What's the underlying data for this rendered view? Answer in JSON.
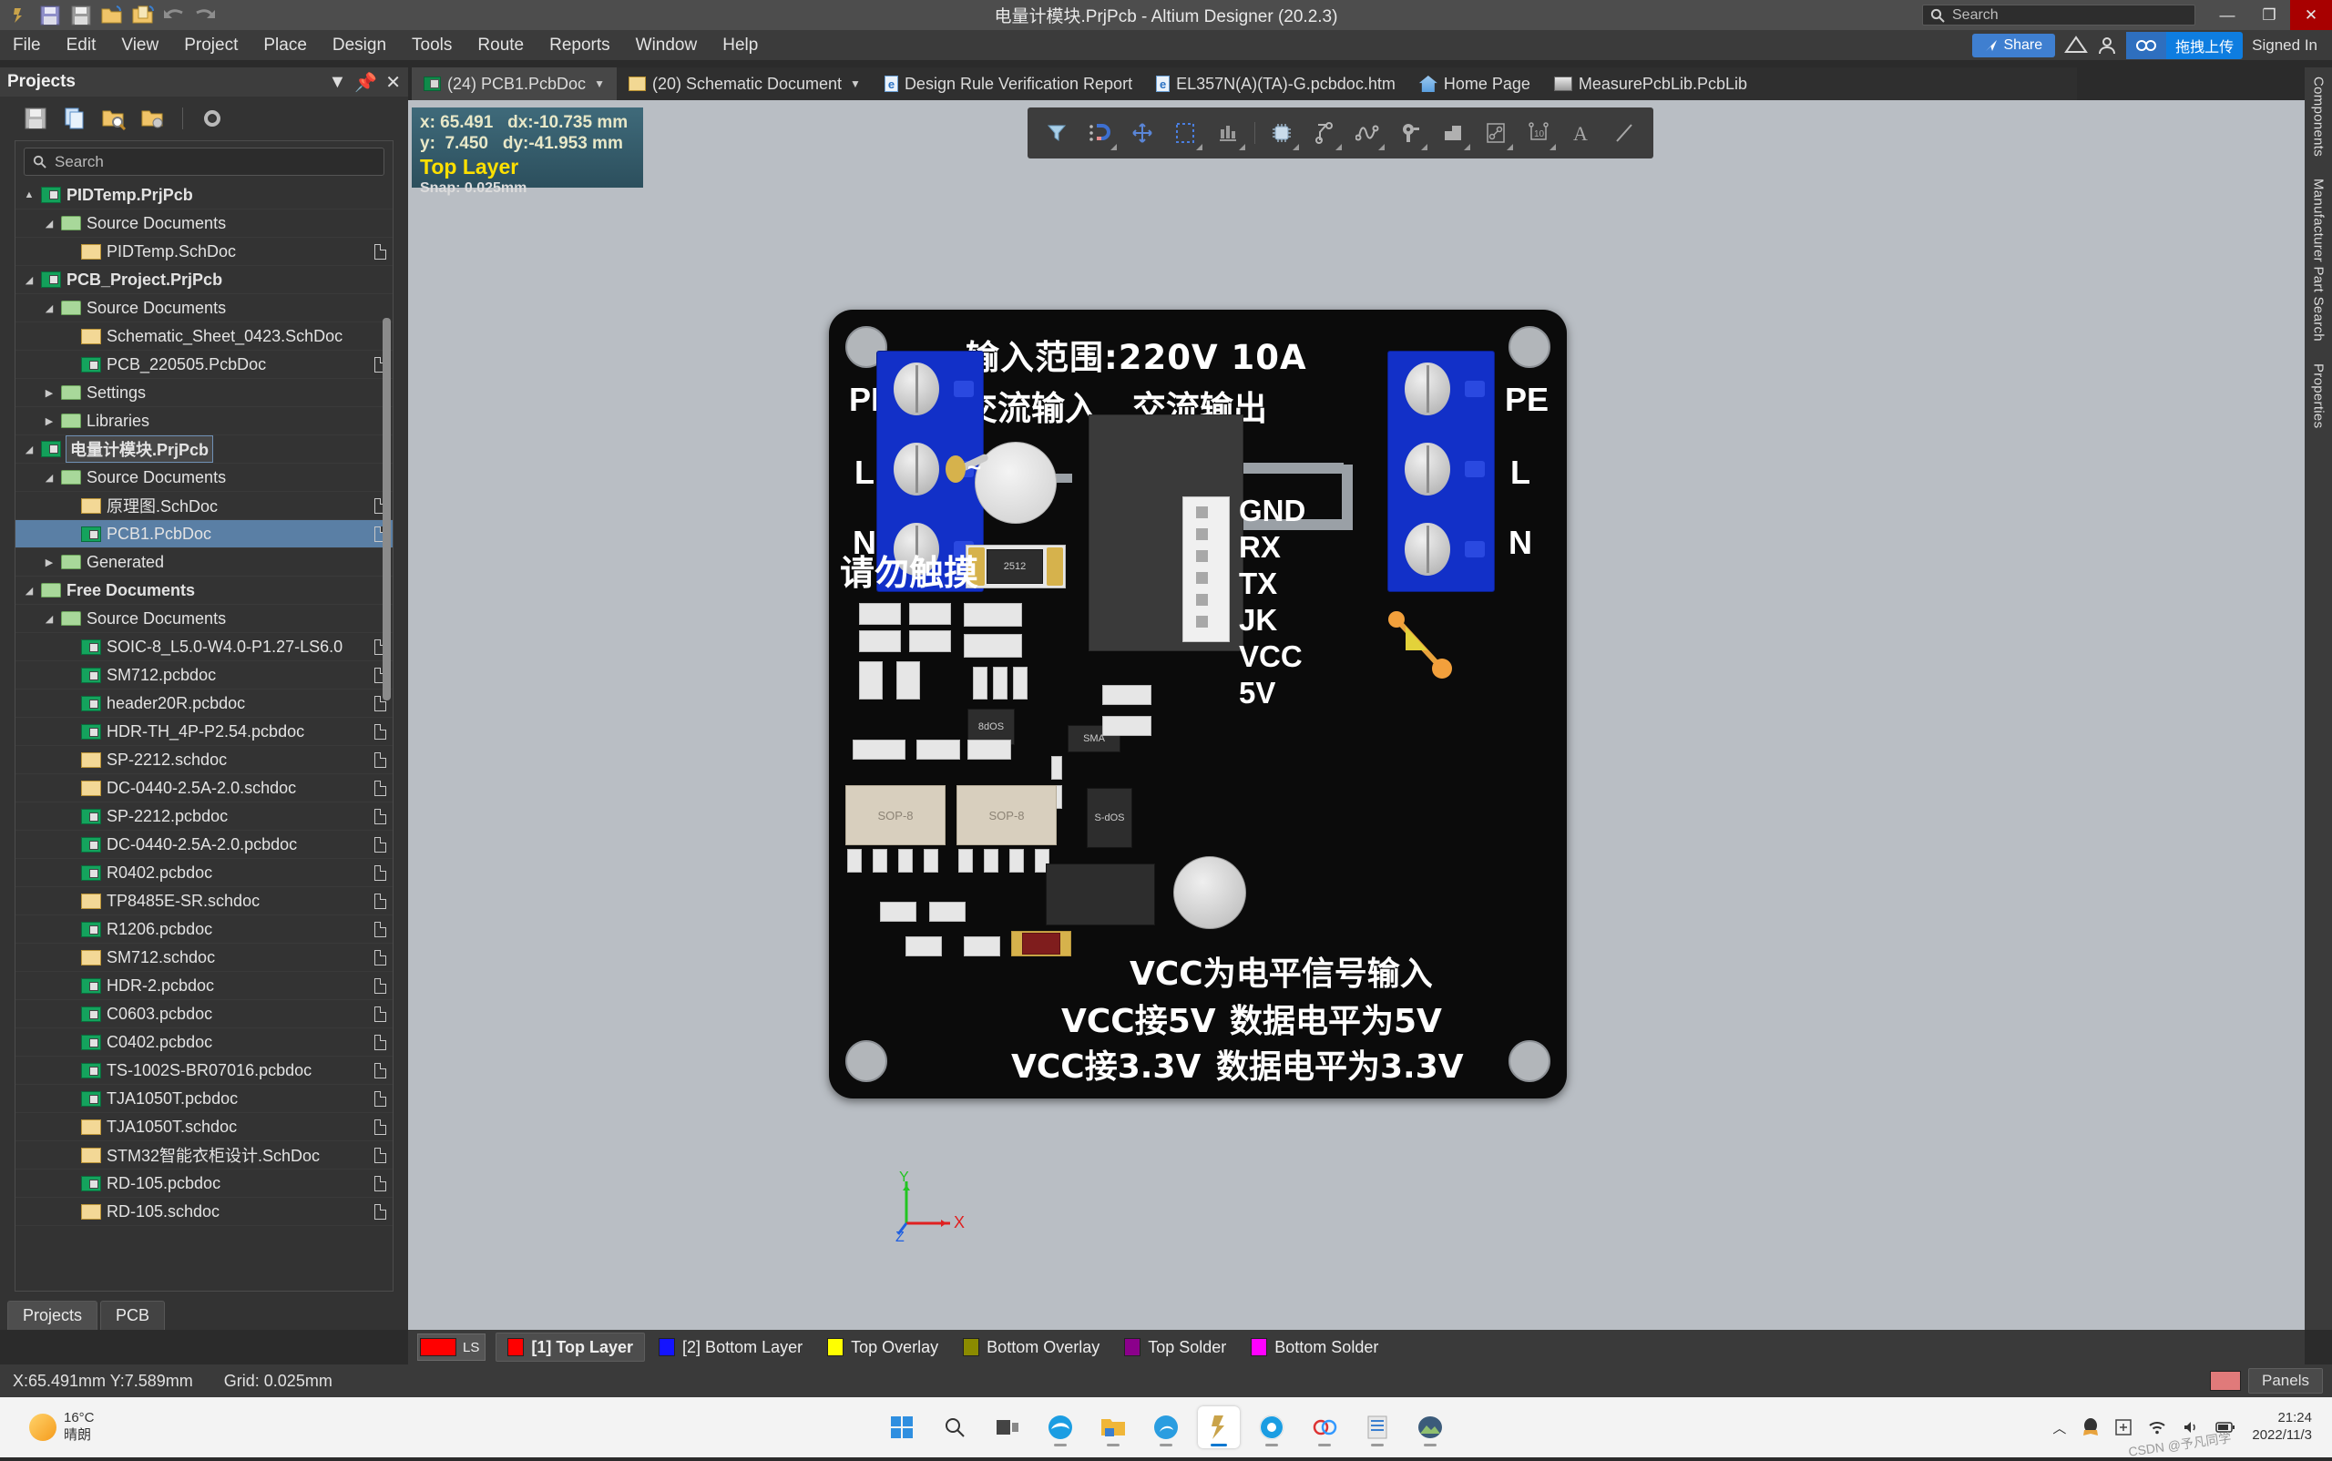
{
  "titlebar": {
    "title": "电量计模块.PrjPcb - Altium Designer (20.2.3)",
    "quick_access": [
      "altium-logo-icon",
      "save-icon",
      "save-all-icon",
      "open-folder-icon",
      "open-document-icon",
      "undo-icon",
      "redo-icon"
    ],
    "search_placeholder": "Search",
    "minimize": "—",
    "restore": "❐",
    "close": "✕"
  },
  "menubar": {
    "items": [
      "File",
      "Edit",
      "View",
      "Project",
      "Place",
      "Design",
      "Tools",
      "Route",
      "Reports",
      "Window",
      "Help"
    ],
    "share_label": "Share",
    "cloud_label": "拖拽上传",
    "signed_in": "Signed In"
  },
  "doc_tabs": [
    {
      "label": "(24) PCB1.PcbDoc",
      "icon": "pcb-doc-icon",
      "active": true,
      "caret": "▼"
    },
    {
      "label": "(20) Schematic Document",
      "icon": "schematic-doc-icon",
      "active": false,
      "caret": "▼"
    },
    {
      "label": "Design Rule Verification Report",
      "icon": "html-doc-icon",
      "active": false,
      "caret": ""
    },
    {
      "label": "EL357N(A)(TA)-G.pcbdoc.htm",
      "icon": "html-doc-icon",
      "active": false,
      "caret": ""
    },
    {
      "label": "Home Page",
      "icon": "home-icon",
      "active": false,
      "caret": ""
    },
    {
      "label": "MeasurePcbLib.PcbLib",
      "icon": "pcb-library-icon",
      "active": false,
      "caret": ""
    }
  ],
  "projects_panel": {
    "title": "Projects",
    "header_icons": [
      "chevron-down-icon",
      "pin-icon",
      "close-icon"
    ],
    "toolbar_icons": [
      "save-icon",
      "compile-icon",
      "search-folder-icon",
      "folder-options-icon",
      "gear-icon"
    ],
    "search_placeholder": "Search",
    "tabs": [
      {
        "label": "Projects",
        "active": true
      },
      {
        "label": "PCB",
        "active": false
      }
    ],
    "tree": [
      {
        "label": "PIDTemp.PrjPcb",
        "indent": 0,
        "icon": "project-icon",
        "arrow": "▲",
        "bold": true,
        "doc": false,
        "sel": false
      },
      {
        "label": "Source Documents",
        "indent": 1,
        "icon": "folder-icon",
        "arrow": "◢",
        "bold": false,
        "doc": false,
        "sel": false
      },
      {
        "label": "PIDTemp.SchDoc",
        "indent": 2,
        "icon": "schdoc-icon",
        "arrow": "",
        "bold": false,
        "doc": true,
        "sel": false
      },
      {
        "label": "PCB_Project.PrjPcb",
        "indent": 0,
        "icon": "project-icon",
        "arrow": "◢",
        "bold": true,
        "doc": false,
        "sel": false
      },
      {
        "label": "Source Documents",
        "indent": 1,
        "icon": "folder-icon",
        "arrow": "◢",
        "bold": false,
        "doc": false,
        "sel": false
      },
      {
        "label": "Schematic_Sheet_0423.SchDoc",
        "indent": 2,
        "icon": "schdoc-icon",
        "arrow": "",
        "bold": false,
        "doc": false,
        "sel": false
      },
      {
        "label": "PCB_220505.PcbDoc",
        "indent": 2,
        "icon": "pcbdoc-icon",
        "arrow": "",
        "bold": false,
        "doc": true,
        "sel": false
      },
      {
        "label": "Settings",
        "indent": 1,
        "icon": "folder-icon",
        "arrow": "▶",
        "bold": false,
        "doc": false,
        "sel": false
      },
      {
        "label": "Libraries",
        "indent": 1,
        "icon": "folder-icon",
        "arrow": "▶",
        "bold": false,
        "doc": false,
        "sel": false
      },
      {
        "label": "电量计模块.PrjPcb",
        "indent": 0,
        "icon": "project-icon",
        "arrow": "◢",
        "bold": true,
        "doc": false,
        "sel": false,
        "outline": true
      },
      {
        "label": "Source Documents",
        "indent": 1,
        "icon": "folder-icon",
        "arrow": "◢",
        "bold": false,
        "doc": false,
        "sel": false
      },
      {
        "label": "原理图.SchDoc",
        "indent": 2,
        "icon": "schdoc-icon",
        "arrow": "",
        "bold": false,
        "doc": true,
        "sel": false
      },
      {
        "label": "PCB1.PcbDoc",
        "indent": 2,
        "icon": "pcbdoc-icon",
        "arrow": "",
        "bold": false,
        "doc": true,
        "sel": true
      },
      {
        "label": "Generated",
        "indent": 1,
        "icon": "folder-icon",
        "arrow": "▶",
        "bold": false,
        "doc": false,
        "sel": false
      },
      {
        "label": "Free Documents",
        "indent": 0,
        "icon": "folder-icon",
        "arrow": "◢",
        "bold": true,
        "doc": false,
        "sel": false
      },
      {
        "label": "Source Documents",
        "indent": 1,
        "icon": "folder-icon",
        "arrow": "◢",
        "bold": false,
        "doc": false,
        "sel": false
      },
      {
        "label": "SOIC-8_L5.0-W4.0-P1.27-LS6.0",
        "indent": 2,
        "icon": "pcbdoc-icon",
        "arrow": "",
        "bold": false,
        "doc": true,
        "sel": false
      },
      {
        "label": "SM712.pcbdoc",
        "indent": 2,
        "icon": "pcbdoc-icon",
        "arrow": "",
        "bold": false,
        "doc": true,
        "sel": false
      },
      {
        "label": "header20R.pcbdoc",
        "indent": 2,
        "icon": "pcbdoc-icon",
        "arrow": "",
        "bold": false,
        "doc": true,
        "sel": false
      },
      {
        "label": "HDR-TH_4P-P2.54.pcbdoc",
        "indent": 2,
        "icon": "pcbdoc-icon",
        "arrow": "",
        "bold": false,
        "doc": true,
        "sel": false
      },
      {
        "label": "SP-2212.schdoc",
        "indent": 2,
        "icon": "schdoc-icon",
        "arrow": "",
        "bold": false,
        "doc": true,
        "sel": false
      },
      {
        "label": "DC-0440-2.5A-2.0.schdoc",
        "indent": 2,
        "icon": "schdoc-icon",
        "arrow": "",
        "bold": false,
        "doc": true,
        "sel": false
      },
      {
        "label": "SP-2212.pcbdoc",
        "indent": 2,
        "icon": "pcbdoc-icon",
        "arrow": "",
        "bold": false,
        "doc": true,
        "sel": false
      },
      {
        "label": "DC-0440-2.5A-2.0.pcbdoc",
        "indent": 2,
        "icon": "pcbdoc-icon",
        "arrow": "",
        "bold": false,
        "doc": true,
        "sel": false
      },
      {
        "label": "R0402.pcbdoc",
        "indent": 2,
        "icon": "pcbdoc-icon",
        "arrow": "",
        "bold": false,
        "doc": true,
        "sel": false
      },
      {
        "label": "TP8485E-SR.schdoc",
        "indent": 2,
        "icon": "schdoc-icon",
        "arrow": "",
        "bold": false,
        "doc": true,
        "sel": false
      },
      {
        "label": "R1206.pcbdoc",
        "indent": 2,
        "icon": "pcbdoc-icon",
        "arrow": "",
        "bold": false,
        "doc": true,
        "sel": false
      },
      {
        "label": "SM712.schdoc",
        "indent": 2,
        "icon": "schdoc-icon",
        "arrow": "",
        "bold": false,
        "doc": true,
        "sel": false
      },
      {
        "label": "HDR-2.pcbdoc",
        "indent": 2,
        "icon": "pcbdoc-icon",
        "arrow": "",
        "bold": false,
        "doc": true,
        "sel": false
      },
      {
        "label": "C0603.pcbdoc",
        "indent": 2,
        "icon": "pcbdoc-icon",
        "arrow": "",
        "bold": false,
        "doc": true,
        "sel": false
      },
      {
        "label": "C0402.pcbdoc",
        "indent": 2,
        "icon": "pcbdoc-icon",
        "arrow": "",
        "bold": false,
        "doc": true,
        "sel": false
      },
      {
        "label": "TS-1002S-BR07016.pcbdoc",
        "indent": 2,
        "icon": "pcbdoc-icon",
        "arrow": "",
        "bold": false,
        "doc": true,
        "sel": false
      },
      {
        "label": "TJA1050T.pcbdoc",
        "indent": 2,
        "icon": "pcbdoc-icon",
        "arrow": "",
        "bold": false,
        "doc": true,
        "sel": false
      },
      {
        "label": "TJA1050T.schdoc",
        "indent": 2,
        "icon": "schdoc-icon",
        "arrow": "",
        "bold": false,
        "doc": true,
        "sel": false
      },
      {
        "label": "STM32智能衣柜设计.SchDoc",
        "indent": 2,
        "icon": "schdoc-icon",
        "arrow": "",
        "bold": false,
        "doc": true,
        "sel": false
      },
      {
        "label": "RD-105.pcbdoc",
        "indent": 2,
        "icon": "pcbdoc-icon",
        "arrow": "",
        "bold": false,
        "doc": true,
        "sel": false
      },
      {
        "label": "RD-105.schdoc",
        "indent": 2,
        "icon": "schdoc-icon",
        "arrow": "",
        "bold": false,
        "doc": true,
        "sel": false
      }
    ]
  },
  "right_dock": {
    "tabs": [
      "Components",
      "Manufacturer Part Search",
      "Properties"
    ]
  },
  "canvas": {
    "coord_box": {
      "line1": "x: 65.491   dx:-10.735 mm",
      "line2": "y:  7.450   dy:-41.953 mm",
      "layer": "Top Layer",
      "snap": "Snap: 0.025mm"
    },
    "float_toolbar_icons": [
      "filter-icon",
      "snap-magnet-icon",
      "move-icon",
      "select-area-icon",
      "align-icon",
      "place-component-icon",
      "place-track-icon",
      "place-trace-icon",
      "place-via-icon",
      "place-fill-icon",
      "place-region-icon",
      "place-dimension-icon",
      "place-text-icon",
      "place-line-icon"
    ],
    "board_silkscreen": {
      "title": "输入范围:220V  10A",
      "ac_in": "交流输入",
      "ac_out": "交流输出",
      "left_terminal_pins": [
        "PE",
        "L",
        "N"
      ],
      "right_terminal_pins": [
        "PE",
        "L",
        "N"
      ],
      "header_pins": [
        "GND",
        "RX",
        "TX",
        "JK",
        "VCC",
        "5V"
      ],
      "warn": "请勿触摸",
      "note1": "VCC为电平信号输入",
      "note2_left": "VCC接5V",
      "note2_right": "数据电平为5V",
      "note3_left": "VCC接3.3V",
      "note3_right": "数据电平为3.3V",
      "res_2512": "2512",
      "sma": "SMA",
      "sop_left": "SOP-8",
      "sop_right": "SOP-8",
      "axis_x": "X",
      "axis_y": "Y",
      "axis_z": "Z"
    }
  },
  "layerbar": {
    "ls_label": "LS",
    "ls_color": "#ff0000",
    "layers": [
      {
        "label": "[1] Top Layer",
        "color": "#ff0000",
        "active": true
      },
      {
        "label": "[2] Bottom Layer",
        "color": "#1414ff",
        "active": false
      },
      {
        "label": "Top Overlay",
        "color": "#ffff00",
        "active": false
      },
      {
        "label": "Bottom Overlay",
        "color": "#8b8b00",
        "active": false
      },
      {
        "label": "Top Solder",
        "color": "#8b008b",
        "active": false
      },
      {
        "label": "Bottom Solder",
        "color": "#ff00ff",
        "active": false
      }
    ]
  },
  "statusbar": {
    "coords": "X:65.491mm Y:7.589mm",
    "grid": "Grid: 0.025mm",
    "panels_label": "Panels",
    "panels_swatch": "#e07a7a"
  },
  "taskbar": {
    "weather_temp": "16°C",
    "weather_desc": "晴朗",
    "apps": [
      "start-icon",
      "search-icon",
      "task-view-icon",
      "edge-icon",
      "file-explorer-icon",
      "edge-beta-icon",
      "altium-designer-icon",
      "chrome-icon",
      "altium365-icon",
      "notes-icon",
      "photos-icon"
    ],
    "tray_icons": [
      "chevron-up-icon",
      "qq-icon",
      "ime-icon",
      "wifi-icon",
      "volume-icon",
      "battery-icon"
    ],
    "clock_time": "21:24",
    "clock_date": "2022/11/3",
    "watermark": "CSDN @予凡同学"
  }
}
